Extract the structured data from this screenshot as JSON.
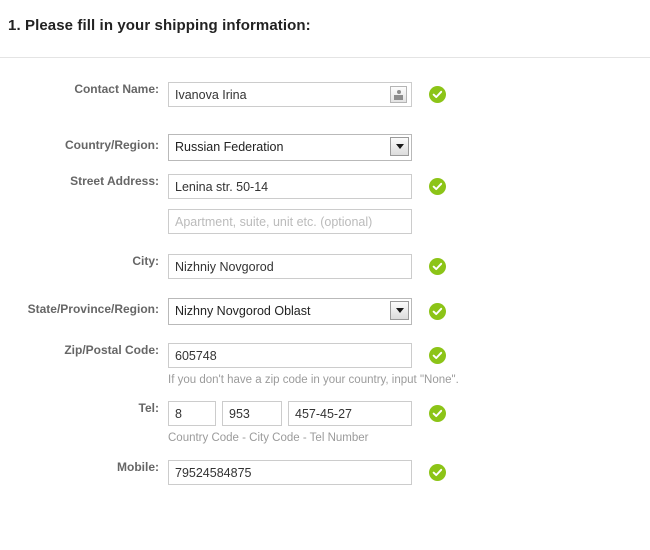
{
  "heading": "1. Please fill in your shipping information:",
  "fields": {
    "contact_name": {
      "label": "Contact Name:",
      "value": "Ivanova Irina",
      "picker_icon": "contact-card-icon",
      "valid": true
    },
    "country": {
      "label": "Country/Region:",
      "value": "Russian Federation",
      "arrow_icon": "chevron-down-icon"
    },
    "street": {
      "label": "Street Address:",
      "value": "Lenina str. 50-14",
      "valid": true
    },
    "apartment": {
      "placeholder": "Apartment, suite, unit etc. (optional)",
      "value": ""
    },
    "city": {
      "label": "City:",
      "value": "Nizhniy Novgorod",
      "valid": true
    },
    "state": {
      "label": "State/Province/Region:",
      "value": "Nizhny Novgorod Oblast",
      "arrow_icon": "chevron-down-icon",
      "valid": true
    },
    "zip": {
      "label": "Zip/Postal Code:",
      "value": "605748",
      "hint": "If you don't have a zip code in your country, input \"None\".",
      "valid": true
    },
    "tel": {
      "label": "Tel:",
      "country_code": "8",
      "city_code": "953",
      "number": "457-45-27",
      "hint": "Country Code - City Code - Tel Number",
      "valid": true
    },
    "mobile": {
      "label": "Mobile:",
      "value": "79524584875",
      "valid": true
    }
  },
  "colors": {
    "valid_green": "#8cc417",
    "label_gray": "#666666",
    "hint_gray": "#9b9b9b",
    "border_gray": "#cccccc"
  }
}
